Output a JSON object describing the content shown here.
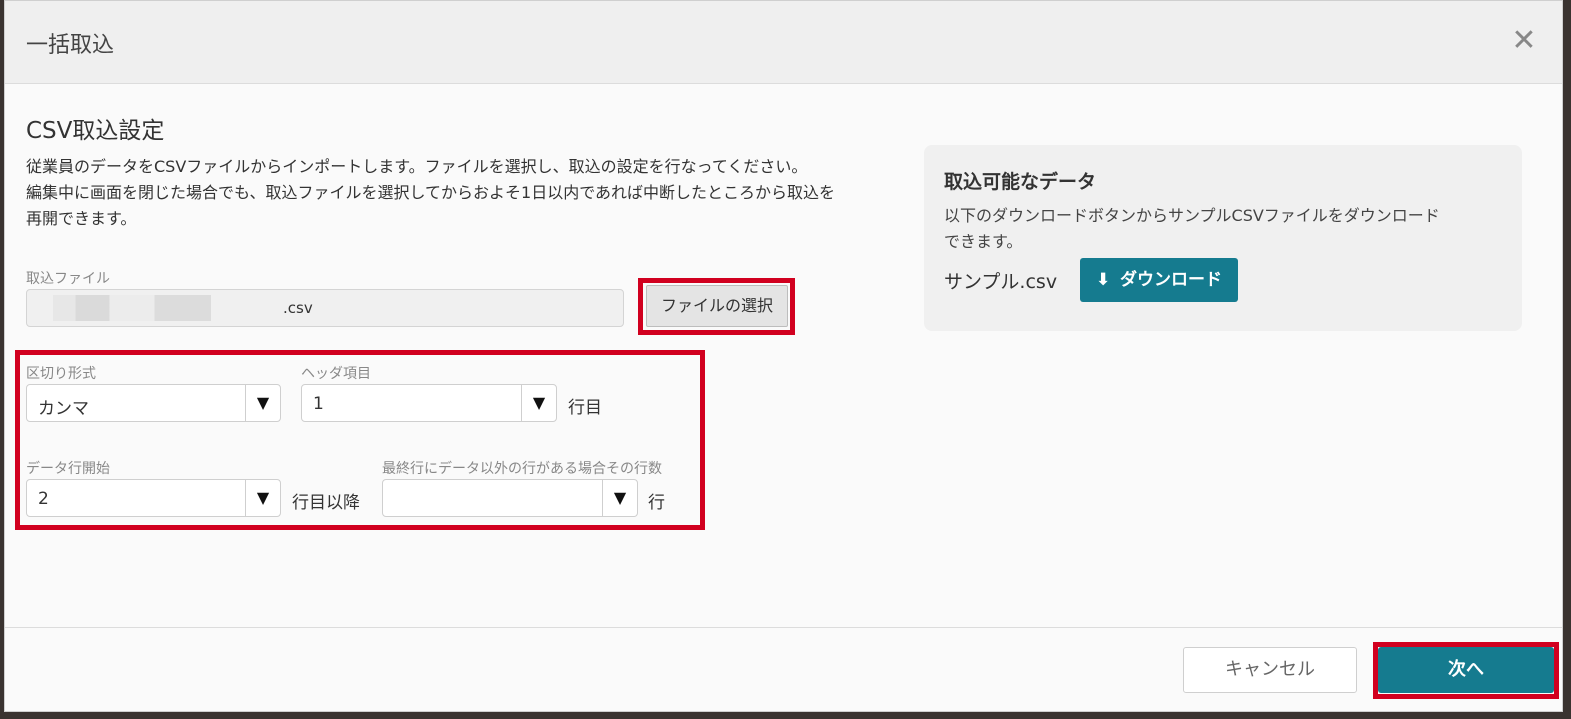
{
  "dialog": {
    "title": "一括取込",
    "close_icon": "close-icon",
    "close_glyph": "✕"
  },
  "main": {
    "section_title": "CSV取込設定",
    "description_lines": [
      "従業員のデータをCSVファイルからインポートします。ファイルを選択し、取込の設定を行なってください。",
      "編集中に画面を閉じた場合でも、取込ファイルを選択してからおよそ1日以内であれば中断したところから取込を",
      "再開できます。"
    ],
    "file": {
      "label": "取込ファイル",
      "value_suffix": ".csv",
      "select_button_label": "ファイルの選択"
    },
    "settings": {
      "delimiter": {
        "label": "区切り形式",
        "value": "カンマ"
      },
      "header_row": {
        "label": "ヘッダ項目",
        "value": "1",
        "suffix": "行目"
      },
      "data_start_row": {
        "label": "データ行開始",
        "value": "2",
        "suffix": "行目以降"
      },
      "trailing_rows": {
        "label": "最終行にデータ以外の行がある場合その行数",
        "value": "",
        "suffix": "行"
      }
    },
    "dropdown_glyph": "▼"
  },
  "side_panel": {
    "title": "取込可能なデータ",
    "description_lines": [
      "以下のダウンロードボタンからサンプルCSVファイルをダウンロード",
      "できます。"
    ],
    "sample_file_name": "サンプル.csv",
    "download_button_label": "ダウンロード",
    "download_icon": "download-icon",
    "download_glyph": "⬇"
  },
  "footer": {
    "cancel_label": "キャンセル",
    "next_label": "次へ"
  },
  "colors": {
    "primary": "#157b8f",
    "highlight": "#d1001f",
    "panel_background": "#f0f0f0"
  }
}
